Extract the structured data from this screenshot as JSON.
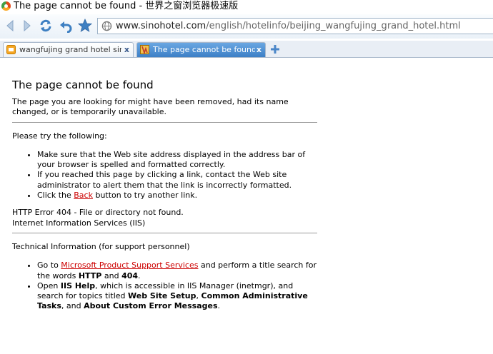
{
  "window": {
    "title": "The page cannot be found - 世界之窗浏览器极速版"
  },
  "nav": {
    "url_host": "www.sinohotel.com",
    "url_path": "/english/hotelinfo/beijing_wangfujing_grand_hotel.html"
  },
  "tabs": [
    {
      "label": "wangfujing grand hotel sinohotel",
      "close": "x",
      "icon": "hotel-favicon-icon"
    },
    {
      "label": "The page cannot be found",
      "close": "x",
      "icon": "iis-favicon-icon"
    }
  ],
  "colors": {
    "link": "#cc0000",
    "active_tab": "#4a8fd4"
  },
  "page": {
    "heading": "The page cannot be found",
    "intro": "The page you are looking for might have been removed, had its name changed, or is temporarily unavailable.",
    "try_label": "Please try the following:",
    "tips": {
      "t1": "Make sure that the Web site address displayed in the address bar of your browser is spelled and formatted correctly.",
      "t2": "If you reached this page by clicking a link, contact the Web site administrator to alert them that the link is incorrectly formatted.",
      "t3_pre": "Click the ",
      "t3_link": "Back",
      "t3_post": " button to try another link."
    },
    "error_line1": "HTTP Error 404 - File or directory not found.",
    "error_line2": "Internet Information Services (IIS)",
    "tech_label": "Technical Information (for support personnel)",
    "tech": {
      "g1_pre": "Go to ",
      "g1_link": "Microsoft Product Support Services",
      "g1_mid": " and perform a title search for the words ",
      "g1_b1": "HTTP",
      "g1_and": " and ",
      "g1_b2": "404",
      "g1_end": ".",
      "g2_pre": "Open ",
      "g2_b1": "IIS Help",
      "g2_mid": ", which is accessible in IIS Manager (inetmgr), and search for topics titled ",
      "g2_b2": "Web Site Setup",
      "g2_c1": ", ",
      "g2_b3": "Common Administrative Tasks",
      "g2_c2": ", and ",
      "g2_b4": "About Custom Error Messages",
      "g2_end": "."
    }
  }
}
